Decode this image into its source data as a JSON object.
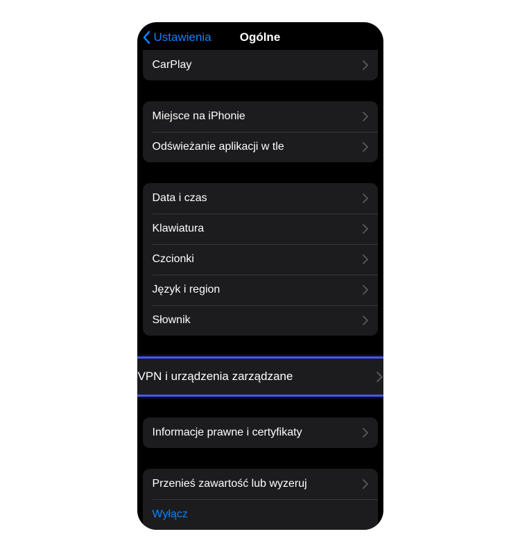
{
  "nav": {
    "back_label": "Ustawienia",
    "title": "Ogólne"
  },
  "groups": {
    "carplay": {
      "items": [
        {
          "label": "CarPlay"
        }
      ]
    },
    "storage": {
      "items": [
        {
          "label": "Miejsce na iPhonie"
        },
        {
          "label": "Odświeżanie aplikacji w tle"
        }
      ]
    },
    "local": {
      "items": [
        {
          "label": "Data i czas"
        },
        {
          "label": "Klawiatura"
        },
        {
          "label": "Czcionki"
        },
        {
          "label": "Język i region"
        },
        {
          "label": "Słownik"
        }
      ]
    },
    "vpn": {
      "items": [
        {
          "label": "VPN i urządzenia zarządzane"
        }
      ]
    },
    "legal": {
      "items": [
        {
          "label": "Informacje prawne i certyfikaty"
        }
      ]
    },
    "reset": {
      "items": [
        {
          "label": "Przenieś zawartość lub wyzeruj"
        },
        {
          "label": "Wyłącz",
          "blue": true,
          "no_chevron": true
        }
      ]
    }
  }
}
